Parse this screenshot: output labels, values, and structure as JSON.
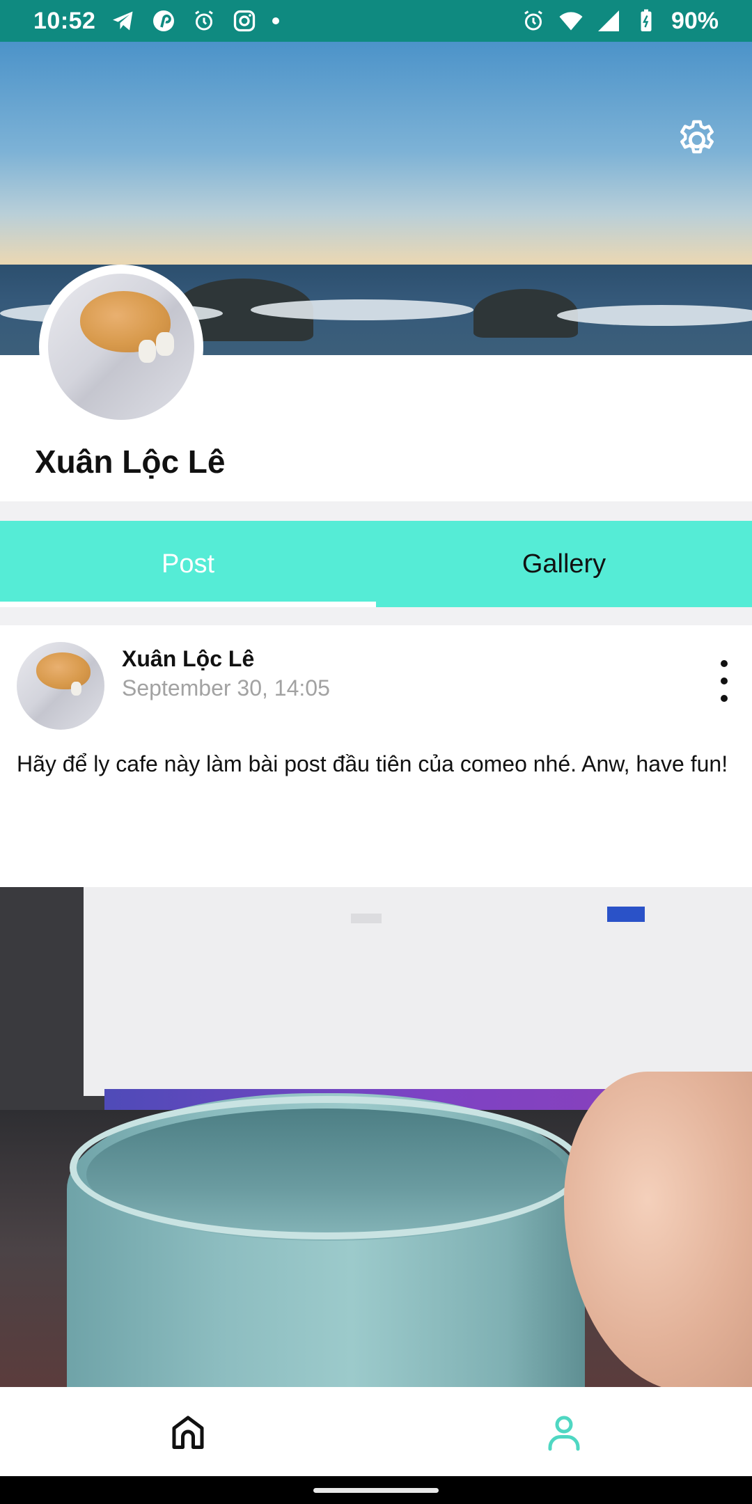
{
  "status_bar": {
    "time": "10:52",
    "battery": "90%",
    "left_icons": [
      "telegram-icon",
      "pinterest-icon",
      "alarm-icon",
      "instagram-icon",
      "dot-icon"
    ],
    "right_icons": [
      "alarm-icon",
      "wifi-icon",
      "signal-icon",
      "battery-icon"
    ]
  },
  "profile": {
    "name": "Xuân Lộc Lê"
  },
  "tabs": {
    "post_label": "Post",
    "gallery_label": "Gallery",
    "active": "Post"
  },
  "post": {
    "author": "Xuân Lộc Lê",
    "timestamp": "September 30, 14:05",
    "text": "Hãy để ly cafe này làm bài post đầu tiên của comeo nhé. Anw, have fun!"
  },
  "bottom_nav": {
    "items": [
      "home-icon",
      "profile-icon"
    ],
    "active": "profile-icon"
  },
  "colors": {
    "status_bar": "#0f8a80",
    "tab_bar": "#55ecd6",
    "accent": "#55ecd6"
  }
}
